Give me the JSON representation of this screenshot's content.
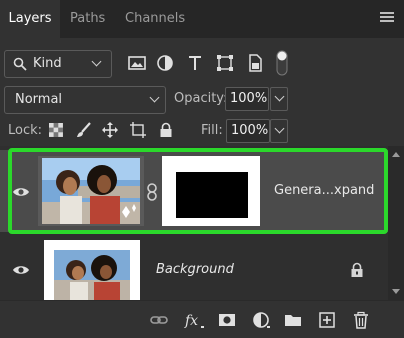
{
  "tabs": [
    {
      "label": "Layers",
      "active": true
    },
    {
      "label": "Paths",
      "active": false
    },
    {
      "label": "Channels",
      "active": false
    }
  ],
  "filter": {
    "kind_label": "Kind",
    "icons": [
      "pixel-layer-filter-icon",
      "adjustment-layer-filter-icon",
      "type-layer-filter-icon",
      "shape-layer-filter-icon",
      "smart-object-filter-icon",
      "filter-toggle-icon"
    ]
  },
  "blend": {
    "mode": "Normal",
    "opacity_label": "Opacity:",
    "opacity_value": "100%",
    "fill_label": "Fill:",
    "fill_value": "100%"
  },
  "lock": {
    "label": "Lock:",
    "icons": [
      "lock-transparent-pixels-icon",
      "lock-image-pixels-icon",
      "lock-position-icon",
      "lock-artboard-icon",
      "lock-all-icon"
    ]
  },
  "layers": [
    {
      "name": "Genera...xpand",
      "selected": true,
      "visible": true,
      "has_mask": true,
      "locked": false
    },
    {
      "name": "Background",
      "selected": false,
      "visible": true,
      "has_mask": false,
      "locked": true
    }
  ],
  "footer_icons": [
    "link-layers-icon",
    "fx-icon",
    "add-mask-icon",
    "adjustment-layer-icon",
    "new-group-icon",
    "new-layer-icon",
    "delete-layer-icon"
  ],
  "colors": {
    "panel_bg": "#323232",
    "tabbar_bg": "#262626",
    "selected_row": "#4b4b4b",
    "highlight_outline": "#2bd82b"
  }
}
